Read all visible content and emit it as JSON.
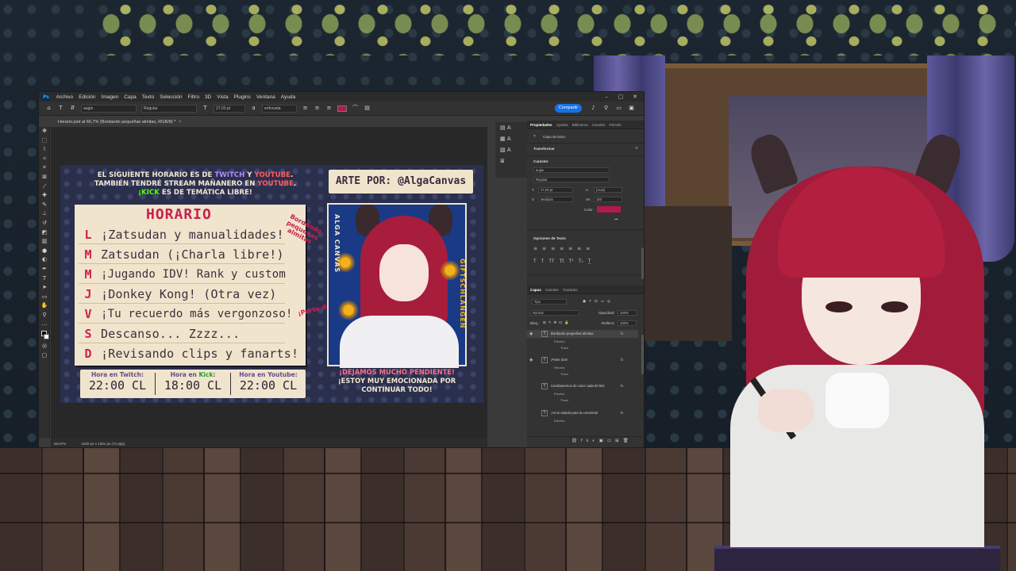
{
  "photoshop": {
    "menu": [
      "Archivo",
      "Edición",
      "Imagen",
      "Capa",
      "Texto",
      "Selección",
      "Filtro",
      "3D",
      "Vista",
      "Plugins",
      "Ventana",
      "Ayuda"
    ],
    "options": {
      "font_family": "augie",
      "font_style": "Regular",
      "font_size": "27,03 pt",
      "antialias": "enfocada",
      "share_label": "Compartir",
      "text_color": "#b01b4a"
    },
    "document_tab": "Horario.psd al 66,7% (Bordando pequeñas almitas, RGB/8) *",
    "status": {
      "zoom": "66,67%",
      "size": "1920 px x 1081 px (72 ppp)"
    },
    "dock_icons": [
      "A",
      "A",
      "A"
    ],
    "panel_tabs": [
      "Propiedades",
      "Ajustes",
      "Biblioteca",
      "Canales",
      "Párrafo"
    ],
    "properties": {
      "layer_type": "Capa de texto",
      "transform": "Transformar",
      "character": "Carácter",
      "font_family": "augie",
      "font_style": "Regular",
      "font_size": "27,03 pt",
      "leading": "(Auto)",
      "kerning": "Medidas",
      "tracking": "100",
      "color_label": "Color",
      "text_options": "Opciones de Texto"
    },
    "layers_tabs": [
      "Capas",
      "Canales",
      "Trazados"
    ],
    "layers_filter": "Tipo",
    "blend_mode": "Normal",
    "opacity_label": "Opacidad:",
    "opacity": "100%",
    "lock_label": "Bloq.:",
    "fill_label": "Relleno:",
    "fill": "100%",
    "layers": [
      {
        "name": "Bordando pequeñas almitas",
        "selected": true,
        "subs": [
          "Efectos",
          "Trazo"
        ]
      },
      {
        "name": "¡Parte dos!",
        "selected": false,
        "subs": [
          "Efectos",
          "Trazo"
        ]
      },
      {
        "name": "Cambiaremos de color cada 50 bits",
        "selected": false,
        "subs": [
          "Efectos",
          "Trazo"
        ]
      },
      {
        "name": "¡Ya te saluda para la conversa!",
        "selected": false,
        "subs": [
          "Efectos"
        ]
      }
    ]
  },
  "artwork": {
    "top_text": {
      "l1a": "EL SIGUIENTE HORARIO ES DE ",
      "l1_twitch": "TWITCH",
      "l1b": " Y ",
      "l1_youtube": "YOUTUBE",
      "l1c": ".",
      "l2a": "TAMBIÉN TENDRÉ STREAM MAÑANERO EN ",
      "l2_youtube": "YOUTUBE",
      "l2b": ".",
      "l3_kick": "¡KICK",
      "l3a": " ES DE TEMÁTICA LIBRE!"
    },
    "arte_por": "ARTE POR: @AlgaCanvas",
    "horario_title": "HORARIO",
    "schedule": [
      {
        "day": "L",
        "text": "¡Zatsudan y manualidades!"
      },
      {
        "day": "M",
        "text": "Zatsudan (¡Charla libre!)"
      },
      {
        "day": "M",
        "text": "¡Jugando IDV! Rank y custom"
      },
      {
        "day": "J",
        "text": "¡Donkey Kong! (Otra vez)"
      },
      {
        "day": "V",
        "text": "¡Tu recuerdo más vergonzoso!"
      },
      {
        "day": "S",
        "text": "Descanso... Zzzz..."
      },
      {
        "day": "D",
        "text": "¡Revisando clips y fanarts!"
      }
    ],
    "note_bordando": "Bordando pequeñas almitas",
    "note_parte_dos": "¡Parte dos!",
    "side_left": "ALGA CANVAS",
    "side_right": "GIFTSCHLANGEN",
    "times": [
      {
        "label_pre": "Hora en ",
        "label_platform": "Twitch",
        "label_post": ":",
        "time": "22:00 CL"
      },
      {
        "label_pre": "Hora en ",
        "label_platform": "Kick",
        "label_post": ":",
        "time": "18:00 CL"
      },
      {
        "label_pre": "Hora en ",
        "label_platform": "Youtube",
        "label_post": ":",
        "time": "22:00 CL"
      }
    ],
    "bottom_right": {
      "l1": "¡DEJAMOS MUCHO PENDIENTE!",
      "l2": "¡ESTOY MUY EMOCIONADA POR",
      "l3": "CONTINUAR TODO!"
    }
  }
}
